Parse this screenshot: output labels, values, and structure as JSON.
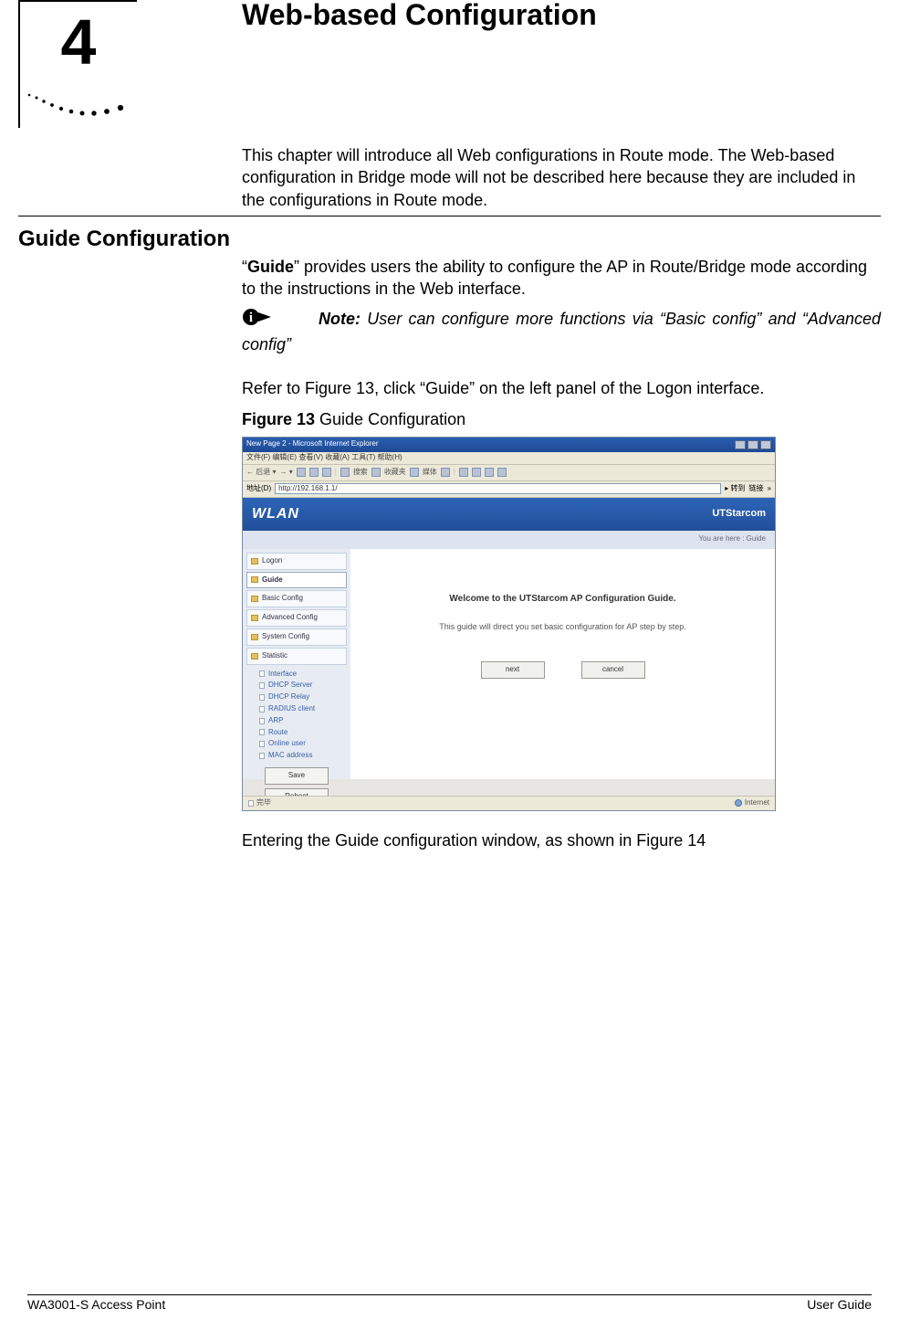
{
  "chapter": {
    "number": "4",
    "title": "Web-based Configuration"
  },
  "intro": "This chapter will introduce all Web configurations in Route mode. The Web-based configuration in Bridge mode will not be described here because they are included in the configurations in Route mode.",
  "section": {
    "heading": "Guide Configuration",
    "para1_pre": "“",
    "para1_strong": "Guide",
    "para1_post": "” provides users the ability to configure the AP in Route/Bridge mode according to the instructions in the Web interface.",
    "note_label": "Note:",
    "note_text": " User can configure more functions via “Basic config” and “Advanced config”",
    "refer": "Refer to Figure 13, click “Guide” on the left panel of the Logon interface.",
    "figure_label": "Figure 13",
    "figure_title": " Guide Configuration",
    "after_shot": "Entering the Guide configuration window, as shown in Figure 14"
  },
  "screenshot": {
    "window_title": "New Page 2 - Microsoft Internet Explorer",
    "menubar": "文件(F)  编辑(E)  查看(V)  收藏(A)  工具(T)  帮助(H)",
    "toolbar_labels": {
      "back": "后退",
      "search": "搜索",
      "fav": "收藏夹",
      "media": "媒体"
    },
    "addr_label": "地址(D)",
    "addr_value": "http://192.168.1.1/",
    "addr_go": "转到",
    "addr_link": "链接",
    "header_left": "WLAN",
    "header_right": "UTStarcom",
    "breadcrumb": "You are here : Guide",
    "nav": [
      {
        "label": "Logon",
        "selected": false
      },
      {
        "label": "Guide",
        "selected": true
      },
      {
        "label": "Basic Config",
        "selected": false
      },
      {
        "label": "Advanced Config",
        "selected": false
      },
      {
        "label": "System Config",
        "selected": false
      },
      {
        "label": "Statistic",
        "selected": false
      }
    ],
    "sub_items": [
      "Interface",
      "DHCP Server",
      "DHCP Relay",
      "RADIUS client",
      "ARP",
      "Route",
      "Online user",
      "MAC address"
    ],
    "side_buttons": {
      "save": "Save",
      "reboot": "Reboot"
    },
    "content": {
      "welcome": "Welcome to the UTStarcom AP Configuration Guide.",
      "guide_text": "This guide will direct you set basic configuration for AP step by step.",
      "next": "next",
      "cancel": "cancel"
    },
    "statusbar": {
      "left": "完毕",
      "right": "Internet"
    }
  },
  "footer": {
    "left": "WA3001-S Access Point",
    "right": "User Guide"
  }
}
